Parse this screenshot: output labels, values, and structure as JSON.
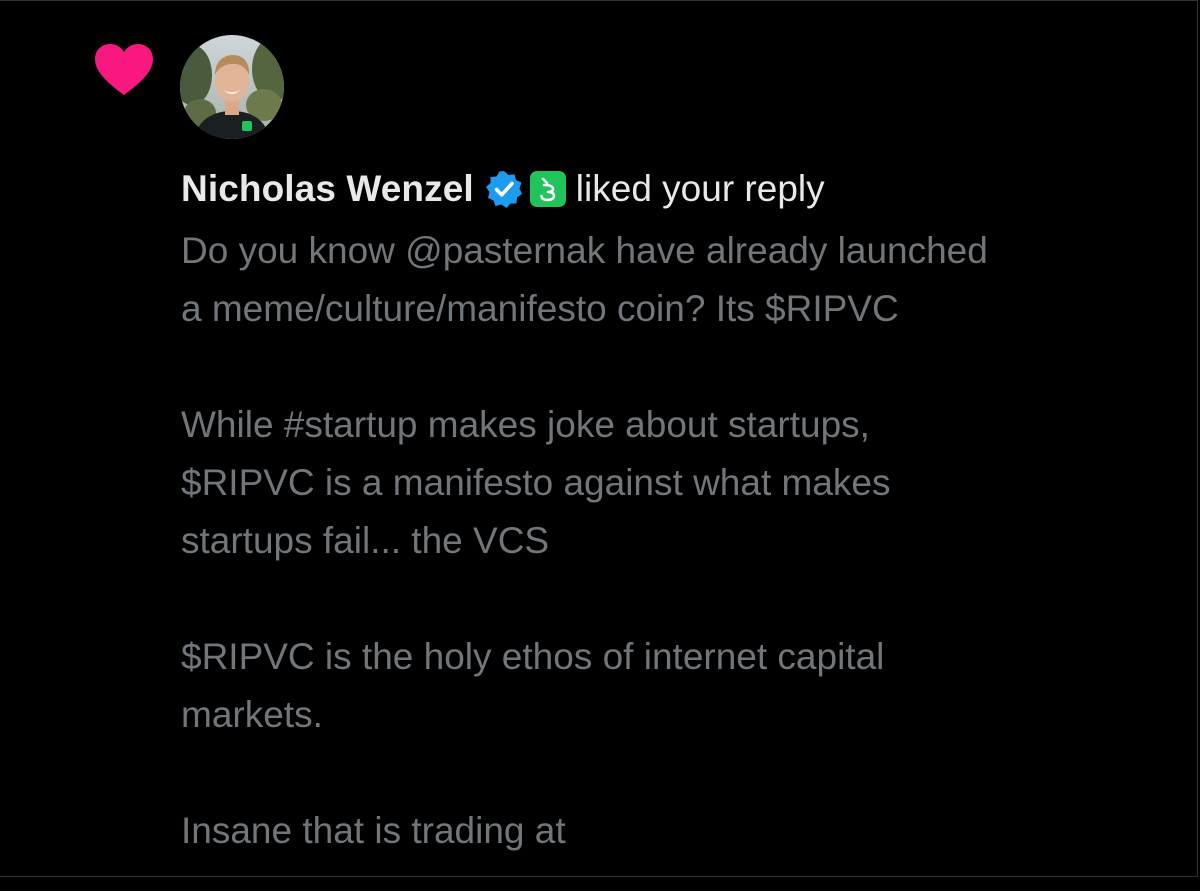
{
  "notification": {
    "type_icon": "heart-icon",
    "type_icon_color": "#f91880",
    "author": {
      "name": "Nicholas Wenzel",
      "verified_badge": "verified-badge-icon",
      "verified_color": "#1d9bf0",
      "affiliate_badge": "affiliate-logo-icon",
      "affiliate_color": "#21c35b"
    },
    "action_text": "liked your reply",
    "reply_lines": [
      "Do you know @pasternak have already launched",
      "a meme/culture/manifesto coin? Its $RIPVC",
      "",
      "While #startup makes joke about startups,",
      "$RIPVC is a manifesto against what makes",
      "startups fail... the VCS",
      "",
      "$RIPVC is the holy ethos of internet capital",
      "markets.",
      "",
      "Insane that is trading at"
    ]
  }
}
